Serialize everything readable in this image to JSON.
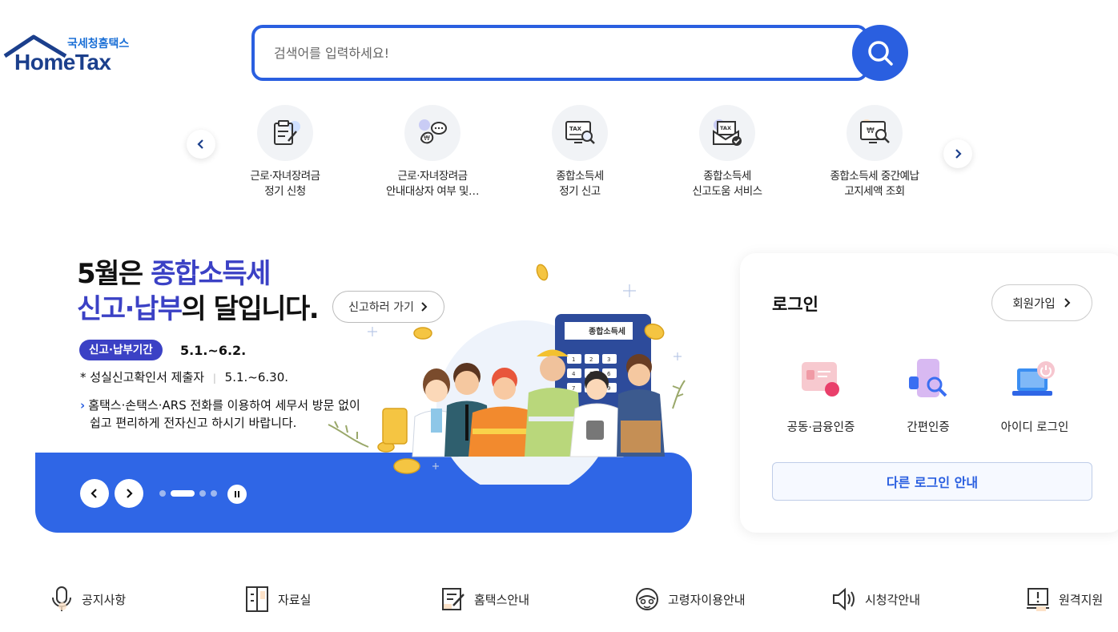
{
  "logo": {
    "ko": "국세청홈택스",
    "en": "HomeTax"
  },
  "search": {
    "placeholder": "검색어를 입력하세요!"
  },
  "quick_menu": [
    {
      "line1": "근로·자녀장려금",
      "line2": "정기 신청",
      "icon": "application-form-icon"
    },
    {
      "line1": "근로·자녀장려금",
      "line2": "안내대상자 여부 및…",
      "icon": "money-chat-icon"
    },
    {
      "line1": "종합소득세",
      "line2": "정기 신고",
      "icon": "tax-monitor-icon"
    },
    {
      "line1": "종합소득세",
      "line2": "신고도움 서비스",
      "icon": "tax-mail-icon"
    },
    {
      "line1": "종합소득세 중간예납",
      "line2": "고지세액 조회",
      "icon": "monitor-search-icon"
    }
  ],
  "banner": {
    "title_line1_a": "5월은 ",
    "title_line1_b": "종합소득세",
    "title_line2_a": "신고·납부",
    "title_line2_b": "의 달입니다.",
    "go_button": "신고하러 가기",
    "period_badge": "신고·납부기간",
    "period_value": "5.1.~6.2.",
    "sub_label": "성실신고확인서 제출자",
    "sub_value": "5.1.~6.30.",
    "desc_line1": "홈택스·손택스·ARS 전화를 이용하여 세무서 방문 없이",
    "desc_line2": "쉽고 편리하게 전자신고 하시기 바랍니다.",
    "calculator_label": "종합소득세",
    "calculator_keys": [
      "1",
      "2",
      "3",
      "4",
      "5",
      "6",
      "7",
      "8",
      "9"
    ],
    "slide_total_dots": 4,
    "slide_active_index": 1
  },
  "login": {
    "title": "로그인",
    "join": "회원가입",
    "options": [
      {
        "label": "공동·금융인증",
        "icon": "certificate-card-icon"
      },
      {
        "label": "간편인증",
        "icon": "simple-auth-icon"
      },
      {
        "label": "아이디 로그인",
        "icon": "id-login-laptop-icon"
      }
    ],
    "other": "다른 로그인 안내"
  },
  "bottom_menu": [
    {
      "label": "공지사항",
      "icon": "microphone-icon"
    },
    {
      "label": "자료실",
      "icon": "archive-icon"
    },
    {
      "label": "홈택스안내",
      "icon": "guide-edit-icon"
    },
    {
      "label": "고령자이용안내",
      "icon": "senior-icon"
    },
    {
      "label": "시청각안내",
      "icon": "speaker-icon"
    },
    {
      "label": "원격지원",
      "icon": "remote-support-icon"
    }
  ],
  "colors": {
    "primary": "#2f66e6",
    "accent": "#3b41c5",
    "logo": "#1b3f8c"
  }
}
